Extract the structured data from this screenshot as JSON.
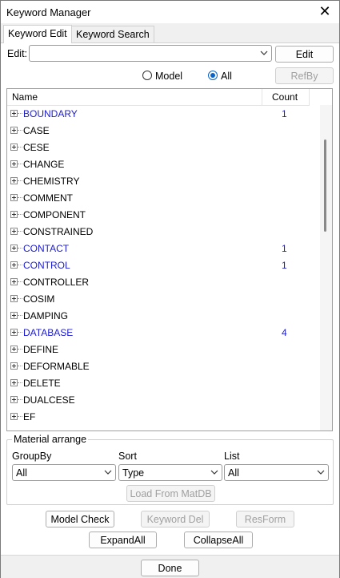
{
  "window": {
    "title": "Keyword Manager"
  },
  "tabs": [
    {
      "label": "Keyword Edit"
    },
    {
      "label": "Keyword Search"
    }
  ],
  "edit": {
    "label": "Edit:",
    "value": "",
    "button": "Edit"
  },
  "filter": {
    "model_label": "Model",
    "all_label": "All",
    "selected": "All",
    "refby_button": "RefBy"
  },
  "tree": {
    "columns": {
      "name": "Name",
      "count": "Count"
    },
    "items": [
      {
        "name": "BOUNDARY",
        "count": "1"
      },
      {
        "name": "CASE",
        "count": ""
      },
      {
        "name": "CESE",
        "count": ""
      },
      {
        "name": "CHANGE",
        "count": ""
      },
      {
        "name": "CHEMISTRY",
        "count": ""
      },
      {
        "name": "COMMENT",
        "count": ""
      },
      {
        "name": "COMPONENT",
        "count": ""
      },
      {
        "name": "CONSTRAINED",
        "count": ""
      },
      {
        "name": "CONTACT",
        "count": "1"
      },
      {
        "name": "CONTROL",
        "count": "1"
      },
      {
        "name": "CONTROLLER",
        "count": ""
      },
      {
        "name": "COSIM",
        "count": ""
      },
      {
        "name": "DAMPING",
        "count": ""
      },
      {
        "name": "DATABASE",
        "count": "4"
      },
      {
        "name": "DEFINE",
        "count": ""
      },
      {
        "name": "DEFORMABLE",
        "count": ""
      },
      {
        "name": "DELETE",
        "count": ""
      },
      {
        "name": "DUALCESE",
        "count": ""
      },
      {
        "name": "EF",
        "count": ""
      }
    ],
    "highlight_color": "#1c1cd0"
  },
  "material_arrange": {
    "title": "Material arrange",
    "groupby": {
      "label": "GroupBy",
      "value": "All"
    },
    "sort": {
      "label": "Sort",
      "value": "Type"
    },
    "list": {
      "label": "List",
      "value": "All"
    },
    "load_button": "Load From MatDB"
  },
  "actions": {
    "model_check": "Model Check",
    "keyword_del": "Keyword Del",
    "resform": "ResForm",
    "expand_all": "ExpandAll",
    "collapse_all": "CollapseAll",
    "done": "Done"
  }
}
